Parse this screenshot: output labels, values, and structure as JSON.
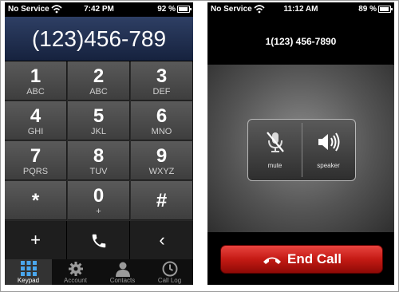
{
  "left_phone": {
    "status": {
      "carrier": "No Service",
      "time": "7:42 PM",
      "battery_pct": "92 %",
      "battery_level": 0.92
    },
    "dialed_number": "(123)456-789",
    "keys": [
      {
        "digit": "1",
        "letters": "ABC"
      },
      {
        "digit": "2",
        "letters": "ABC"
      },
      {
        "digit": "3",
        "letters": "DEF"
      },
      {
        "digit": "4",
        "letters": "GHI"
      },
      {
        "digit": "5",
        "letters": "JKL"
      },
      {
        "digit": "6",
        "letters": "MNO"
      },
      {
        "digit": "7",
        "letters": "PQRS"
      },
      {
        "digit": "8",
        "letters": "TUV"
      },
      {
        "digit": "9",
        "letters": "WXYZ"
      },
      {
        "digit": "*",
        "letters": ""
      },
      {
        "digit": "0",
        "letters": "+"
      },
      {
        "digit": "#",
        "letters": ""
      }
    ],
    "actions": {
      "add": "+",
      "backspace": "‹"
    },
    "tabs": [
      {
        "label": "Keypad",
        "icon": "keypad-grid-icon",
        "active": true
      },
      {
        "label": "Account",
        "icon": "gear-icon",
        "active": false
      },
      {
        "label": "Contacts",
        "icon": "contacts-icon",
        "active": false
      },
      {
        "label": "Call Log",
        "icon": "clock-icon",
        "active": false
      }
    ]
  },
  "right_phone": {
    "status": {
      "carrier": "No Service",
      "time": "11:12 AM",
      "battery_pct": "89 %",
      "battery_level": 0.89
    },
    "call_number": "1(123) 456-7890",
    "controls": {
      "mute_label": "mute",
      "speaker_label": "speaker"
    },
    "end_call_label": "End Call"
  },
  "colors": {
    "end_call_red": "#c41a14",
    "display_blue": "#2e3f64",
    "active_tab": "#333333"
  }
}
